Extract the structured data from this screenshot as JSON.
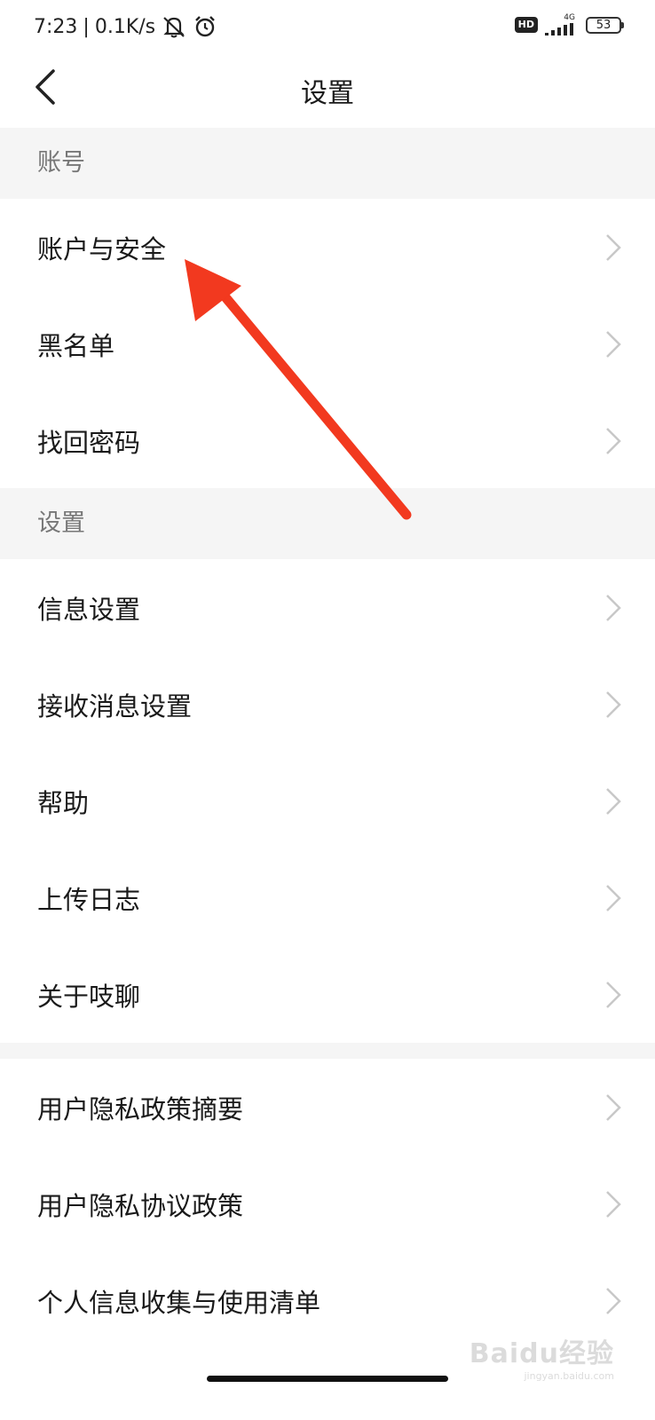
{
  "status_bar": {
    "time": "7:23",
    "separator": "|",
    "net_speed": "0.1K/s",
    "hd_label": "HD",
    "network_type": "4G",
    "battery": "53"
  },
  "header": {
    "title": "设置"
  },
  "sections": [
    {
      "title": "账号",
      "items": [
        {
          "label": "账户与安全"
        },
        {
          "label": "黑名单"
        },
        {
          "label": "找回密码"
        }
      ]
    },
    {
      "title": "设置",
      "items": [
        {
          "label": "信息设置"
        },
        {
          "label": "接收消息设置"
        },
        {
          "label": "帮助"
        },
        {
          "label": "上传日志"
        },
        {
          "label": "关于吱聊"
        }
      ]
    },
    {
      "title": "",
      "items": [
        {
          "label": "用户隐私政策摘要"
        },
        {
          "label": "用户隐私协议政策"
        },
        {
          "label": "个人信息收集与使用清单"
        }
      ]
    }
  ],
  "watermark": {
    "text": "Baidu经验",
    "sub": "jingyan.baidu.com"
  },
  "colors": {
    "annotation_arrow": "#f2391f",
    "section_bg": "#f5f5f5",
    "chevron": "#c8c8c8"
  }
}
